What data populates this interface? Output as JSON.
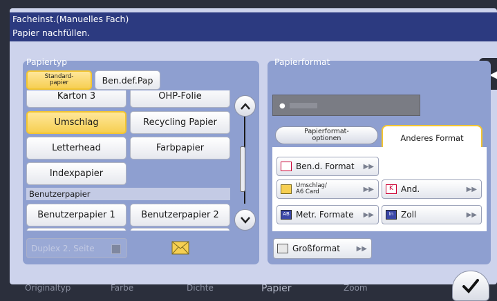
{
  "background_tabs": [
    "Originaltyp",
    "Farbe",
    "Dichte",
    "Papier",
    "Zoom"
  ],
  "title": "Facheinst.(Manuelles Fach)",
  "message": "Papier nachfüllen.",
  "paper_type": {
    "title": "Papiertyp",
    "tab_standard": "Standard-\npapier",
    "tab_user_def": "Ben.def.Pap",
    "buttons": [
      "Karton 3",
      "OHP-Folie",
      "Umschlag",
      "Recycling Papier",
      "Letterhead",
      "Farbpapier",
      "Indexpapier"
    ],
    "selected": "Umschlag",
    "user_section": "Benutzerpapier",
    "user_buttons": [
      "Benutzerpapier 1",
      "Benutzerpapier 2"
    ],
    "duplex_label": "Duplex 2. Seite"
  },
  "paper_format": {
    "title": "Papierformat",
    "tab_options": "Papierformat-\noptionen",
    "tab_other": "Anderes Format",
    "btn_user_format": "Ben.d. Format",
    "btn_envelope": "Umschlag/\nA6 Card",
    "btn_other": "And.",
    "btn_metric": "Metr. Formate",
    "btn_inch": "Zoll",
    "btn_large": "Großformat"
  },
  "colors": {
    "accent": "#f3c530",
    "title_bar": "#2c3a80",
    "panel": "#8e9fd0"
  }
}
